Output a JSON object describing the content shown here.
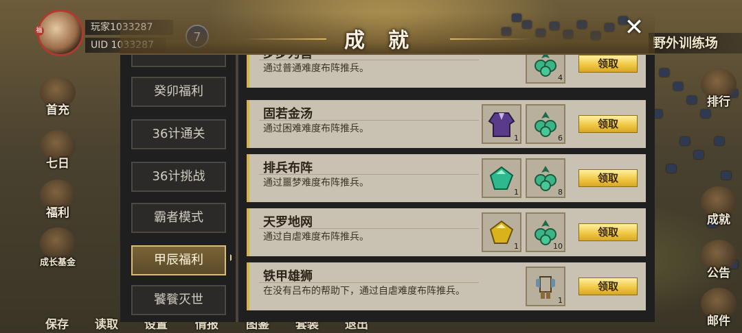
{
  "player": {
    "name": "玩家1033287",
    "uid": "UID  1033287",
    "level": "7",
    "avatar_badge": "福"
  },
  "left_menu": [
    {
      "label": "首充",
      "icon": "gift-icon"
    },
    {
      "label": "七日",
      "icon": "scroll-icon"
    },
    {
      "label": "福利",
      "icon": "welfare-icon"
    },
    {
      "label": "成长基金",
      "icon": "coin-pile-icon"
    }
  ],
  "right_menu": [
    {
      "label": "排行",
      "icon": "ranking-icon"
    },
    {
      "label": "成就",
      "icon": "achievement-icon"
    },
    {
      "label": "公告",
      "icon": "announcement-icon"
    },
    {
      "label": "邮件",
      "icon": "mail-icon"
    }
  ],
  "bottom_bar": [
    "保存",
    "读取",
    "设置",
    "情报",
    "图鉴",
    "套装",
    "退出"
  ],
  "area_name": "野外训练场",
  "dialog": {
    "title": "成就",
    "close_symbol": "✕",
    "tabs": [
      {
        "label": "",
        "active": false
      },
      {
        "label": "癸卯福利",
        "active": false
      },
      {
        "label": "36计通关",
        "active": false
      },
      {
        "label": "36计挑战",
        "active": false
      },
      {
        "label": "霸者模式",
        "active": false
      },
      {
        "label": "甲辰福利",
        "active": true
      },
      {
        "label": "饕餮灭世",
        "active": false
      }
    ],
    "claim_label": "领取",
    "achievements": [
      {
        "title": "步步为营",
        "desc": "通过普通难度布阵推兵。",
        "rewards": [
          {
            "icon": "jade-pendant-icon",
            "count": "4"
          }
        ]
      },
      {
        "title": "固若金汤",
        "desc": "通过困难难度布阵推兵。",
        "rewards": [
          {
            "icon": "purple-robe-icon",
            "count": "1"
          },
          {
            "icon": "jade-pendant-icon",
            "count": "6"
          }
        ]
      },
      {
        "title": "排兵布阵",
        "desc": "通过噩梦难度布阵推兵。",
        "rewards": [
          {
            "icon": "green-gem-icon",
            "count": "1"
          },
          {
            "icon": "jade-pendant-icon",
            "count": "8"
          }
        ]
      },
      {
        "title": "天罗地网",
        "desc": "通过自虐难度布阵推兵。",
        "rewards": [
          {
            "icon": "yellow-gem-icon",
            "count": "1"
          },
          {
            "icon": "jade-pendant-icon",
            "count": "10"
          }
        ]
      },
      {
        "title": "铁甲雄狮",
        "desc": "在没有吕布的帮助下，通过自虐难度布阵推兵。",
        "rewards": [
          {
            "icon": "armor-icon",
            "count": "1"
          }
        ]
      }
    ]
  },
  "colors": {
    "row_bg": "#c9c2b2",
    "row_accent": "#d8b443",
    "claim_button": "#efc53f",
    "dialog_bg": "#1f1f1f",
    "active_tab": "#7a6436"
  }
}
